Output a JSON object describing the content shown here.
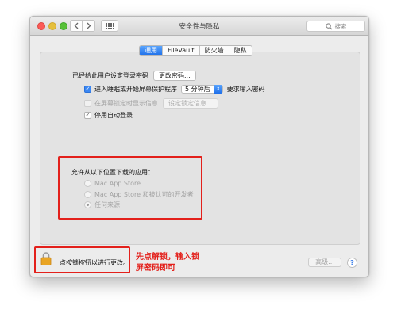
{
  "window": {
    "title": "安全性与隐私",
    "search_placeholder": "搜索"
  },
  "tabs": [
    {
      "label": "通用",
      "active": true
    },
    {
      "label": "FileVault",
      "active": false
    },
    {
      "label": "防火墙",
      "active": false
    },
    {
      "label": "隐私",
      "active": false
    }
  ],
  "general": {
    "password_set_label": "已经给此用户设定登录密码",
    "change_password_button": "更改密码...",
    "require_password_label": "进入睡眠或开始屏幕保护程序",
    "require_password_delay": "5 分钟后",
    "require_password_suffix": "要求输入密码",
    "show_message_label": "在屏幕锁定时显示信息",
    "set_lock_message_button": "设定锁定信息...",
    "disable_auto_login_label": "停用自动登录"
  },
  "download_section": {
    "heading": "允许从以下位置下载的应用：",
    "options": [
      {
        "label": "Mac App Store",
        "selected": false
      },
      {
        "label": "Mac App Store 和被认可的开发者",
        "selected": false
      },
      {
        "label": "任何来源",
        "selected": true
      }
    ]
  },
  "footer": {
    "lock_text": "点按锁按钮以进行更改。",
    "advanced_button": "高级...",
    "help_button": "?"
  },
  "annotation": {
    "line1": "先点解锁，输入锁",
    "line2": "屏密码即可"
  },
  "colors": {
    "accent_blue": "#3b87f2",
    "annotation_red": "#e3201b"
  }
}
